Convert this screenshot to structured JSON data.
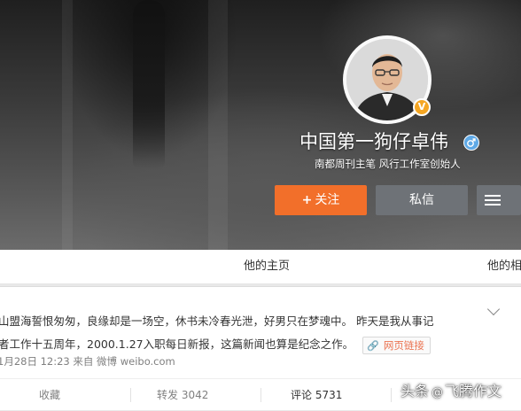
{
  "profile": {
    "name": "中国第一狗仔卓伟",
    "bio": "南都周刊主笔 风行工作室创始人",
    "verified_badge": "V",
    "verified_badge_color": "#f5a623",
    "gender_icon": "male-icon",
    "gender_color": "#5fa9e6"
  },
  "actions": {
    "follow_plus": "+",
    "follow_label": "关注",
    "follow_color": "#f26f2a",
    "message_label": "私信",
    "menu_icon": "hamburger-menu-icon"
  },
  "nav": {
    "tabs": [
      "他的主页",
      "他的相"
    ]
  },
  "post": {
    "line1": "山盟海誓恨匆匆，良缘却是一场空，休书未冷春光泄，好男只在梦魂中。 昨天是我从事记",
    "line2": "者工作十五周年，2000.1.27入职每日新报，这篇新闻也算是纪念之作。",
    "link_icon": "link-icon",
    "link_label": "网页链接",
    "link_color": "#eb7350",
    "meta": "1月28日 12:23 来自 微博 weibo.com",
    "expand_icon": "chevron-down-icon"
  },
  "post_actions": {
    "favorite": "收藏",
    "repost": "转发 3042",
    "comment": "评论 5731"
  },
  "watermark": {
    "prefix": "头条",
    "logo": "@",
    "author": "飞腾作文"
  }
}
